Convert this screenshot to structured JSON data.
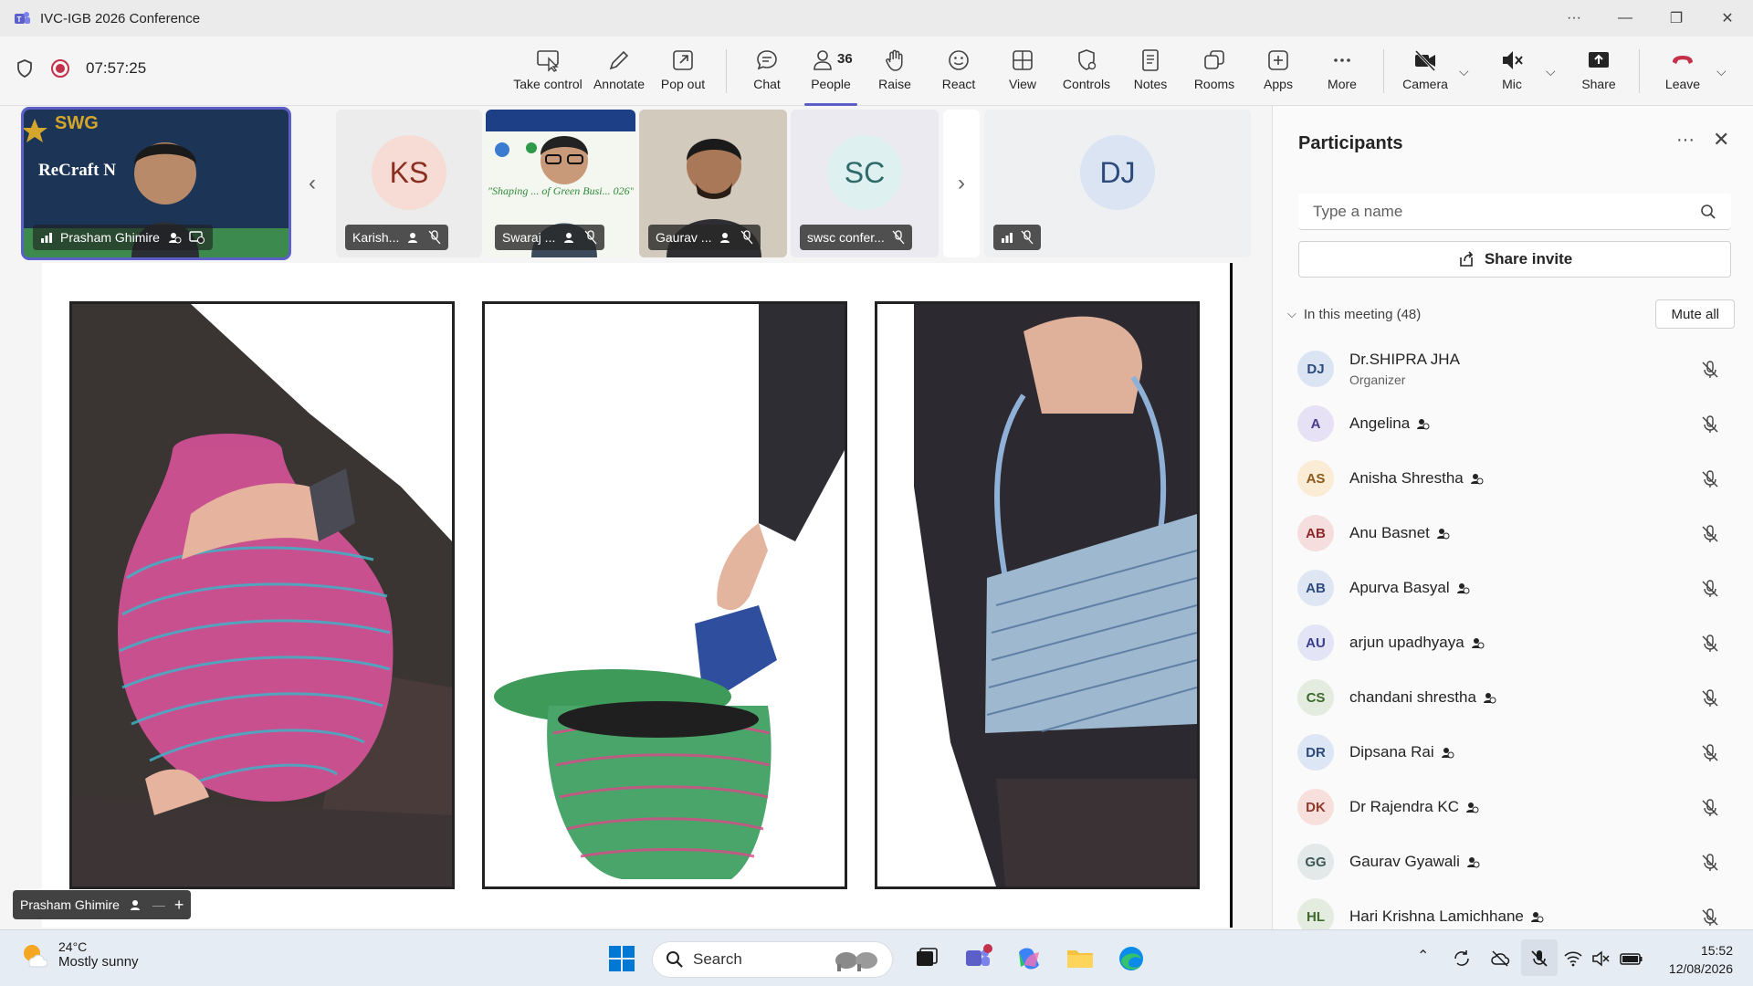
{
  "window": {
    "title": "IVC-IGB 2026 Conference",
    "more": "···"
  },
  "toolbar": {
    "timer": "07:57:25",
    "buttons": [
      {
        "label": "Take control",
        "icon": "take-control-icon"
      },
      {
        "label": "Annotate",
        "icon": "pen-icon"
      },
      {
        "label": "Pop out",
        "icon": "pop-out-icon"
      },
      {
        "label": "Chat",
        "icon": "chat-icon"
      },
      {
        "label": "People",
        "icon": "people-icon",
        "count": "36",
        "active": true
      },
      {
        "label": "Raise",
        "icon": "hand-icon"
      },
      {
        "label": "React",
        "icon": "smiley-icon"
      },
      {
        "label": "View",
        "icon": "grid-view-icon"
      },
      {
        "label": "Controls",
        "icon": "controls-icon"
      },
      {
        "label": "Notes",
        "icon": "notes-icon"
      },
      {
        "label": "Rooms",
        "icon": "rooms-icon"
      },
      {
        "label": "Apps",
        "icon": "apps-icon"
      },
      {
        "label": "More",
        "icon": "more-icon"
      },
      {
        "label": "Camera",
        "icon": "camera-off-icon"
      },
      {
        "label": "Mic",
        "icon": "mic-off-icon"
      },
      {
        "label": "Share",
        "icon": "share-icon"
      },
      {
        "label": "Leave",
        "icon": "leave-icon"
      }
    ],
    "leave_color": "#c4314b",
    "accent": "#5b5fc7"
  },
  "strip": {
    "tiles": [
      {
        "name": "Prasham Ghimire",
        "type": "video",
        "slide_brand": "SWG",
        "slide_title": "ReCraft N"
      },
      {
        "name": "Karish...",
        "type": "avatar",
        "initials": "KS"
      },
      {
        "name": "Swaraj ...",
        "type": "video",
        "slide_text": "\"Shaping ... of Green Busi... 026\""
      },
      {
        "name": "Gaurav ...",
        "type": "video"
      },
      {
        "name": "swsc confer...",
        "type": "avatar",
        "initials": "SC"
      },
      {
        "name": "",
        "type": "avatar",
        "initials": "DJ"
      }
    ]
  },
  "stage": {
    "presenter": "Prasham Ghimire",
    "photos": [
      "woven-pot",
      "woven-basket",
      "woven-bag"
    ]
  },
  "panel": {
    "title": "Participants",
    "search_placeholder": "Type a name",
    "share_invite": "Share invite",
    "section_label": "In this meeting (48)",
    "mute_all": "Mute all",
    "participants": [
      {
        "initials": "DJ",
        "name": "Dr.SHIPRA JHA",
        "role": "Organizer",
        "bg": "#dbe4f3",
        "fg": "#2c4a7a"
      },
      {
        "initials": "A",
        "name": "Angelina",
        "bg": "#e6e1f4",
        "fg": "#4b3a8c"
      },
      {
        "initials": "AS",
        "name": "Anisha Shrestha",
        "bg": "#fbecd6",
        "fg": "#8a5a1c"
      },
      {
        "initials": "AB",
        "name": "Anu Basnet",
        "bg": "#f7dede",
        "fg": "#8c2a2a"
      },
      {
        "initials": "AB",
        "name": "Apurva Basyal",
        "bg": "#dfe6f3",
        "fg": "#2f4d7c"
      },
      {
        "initials": "AU",
        "name": "arjun upadhyaya",
        "bg": "#e3e4f6",
        "fg": "#3a3f8c"
      },
      {
        "initials": "CS",
        "name": "chandani shrestha",
        "bg": "#e4ecdf",
        "fg": "#3f6a2e"
      },
      {
        "initials": "DR",
        "name": "Dipsana Rai",
        "bg": "#dde6f4",
        "fg": "#2c4a7a"
      },
      {
        "initials": "DK",
        "name": "Dr Rajendra KC",
        "bg": "#f7e0dc",
        "fg": "#8c3a2a"
      },
      {
        "initials": "GG",
        "name": "Gaurav Gyawali",
        "bg": "#e3e8e8",
        "fg": "#3e5656"
      },
      {
        "initials": "HL",
        "name": "Hari Krishna Lamichhane",
        "bg": "#e4ecdf",
        "fg": "#3f6a2e"
      }
    ]
  },
  "taskbar": {
    "temp": "24°C",
    "weather": "Mostly sunny",
    "search": "Search",
    "time": "15:52",
    "date": "12/08/2026"
  }
}
